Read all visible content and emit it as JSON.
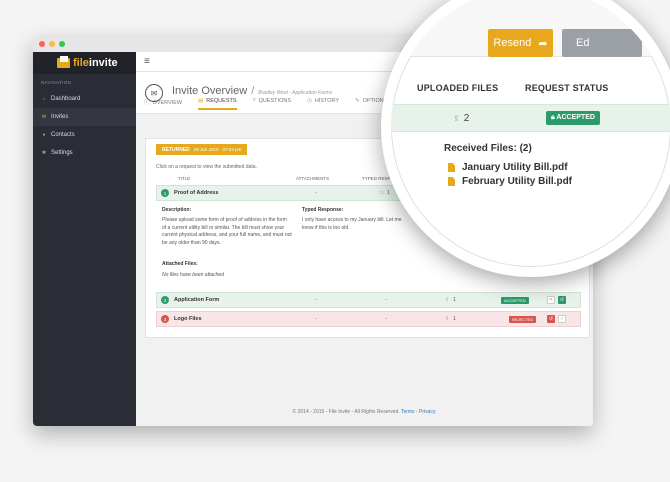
{
  "sidebar": {
    "logo_a": "file",
    "logo_b": "invite",
    "nav_heading": "NAVIGATION",
    "items": [
      {
        "label": "Dashboard",
        "icon": "home-icon"
      },
      {
        "label": "Invites",
        "icon": "envelope-icon"
      },
      {
        "label": "Contacts",
        "icon": "users-icon"
      },
      {
        "label": "Settings",
        "icon": "gear-icon"
      }
    ]
  },
  "header": {
    "title": "Invite Overview",
    "subtitle": "Bradley West - Application Forms"
  },
  "tabs": [
    "OVERVIEW",
    "REQUESTS",
    "QUESTIONS",
    "HISTORY",
    "OPTIONS"
  ],
  "panel": {
    "returned_label": "RETURNED",
    "returned_date": "28 Jun 2015 - 07:54 pm",
    "hint": "Click on a request to view the submitted data.",
    "columns": {
      "title": "TITLE",
      "attachments": "ATTACHMENTS",
      "typed": "TYPED RESPONSES",
      "uploaded_partial": "OW"
    },
    "rows": [
      {
        "num": "1",
        "name": "Proof of Address",
        "attachments": "-",
        "typed": "1"
      },
      {
        "num": "2",
        "name": "Application Form",
        "attachments": "-",
        "typed": "-",
        "uploaded": "1",
        "status": "ACCEPTED"
      },
      {
        "num": "3",
        "name": "Logo Files",
        "attachments": "-",
        "typed": "-",
        "uploaded": "1",
        "status": "REJECTED"
      }
    ],
    "details": {
      "desc_label": "Description:",
      "desc_text": "Please upload some form of proof of address in the form of a current utility bill or similar. The bill must show your current physical address, and your full name, and must not be any older than 90 days.",
      "typed_label": "Typed Response:",
      "typed_text": "I only have access to my January bill. Let me know if this is too old.",
      "attached_label": "Attached Files:",
      "attached_text": "No files have been attached"
    }
  },
  "footer": {
    "text": "© 2014 - 2015 - File Invite - All Rights Reserved.",
    "terms": "Terms",
    "privacy": "Privacy"
  },
  "lens": {
    "resend": "Resend",
    "edit": "Ed",
    "col_uploaded": "UPLOADED FILES",
    "col_status": "REQUEST STATUS",
    "count": "2",
    "status": "ACCEPTED",
    "received_label": "Received Files: (2)",
    "files": [
      "January Utility Bill.pdf",
      "February Utility Bill.pdf"
    ]
  },
  "colors": {
    "accent": "#e8a81c",
    "success": "#2c9a6b",
    "danger": "#d9534f",
    "sidebar": "#2b2d36"
  }
}
